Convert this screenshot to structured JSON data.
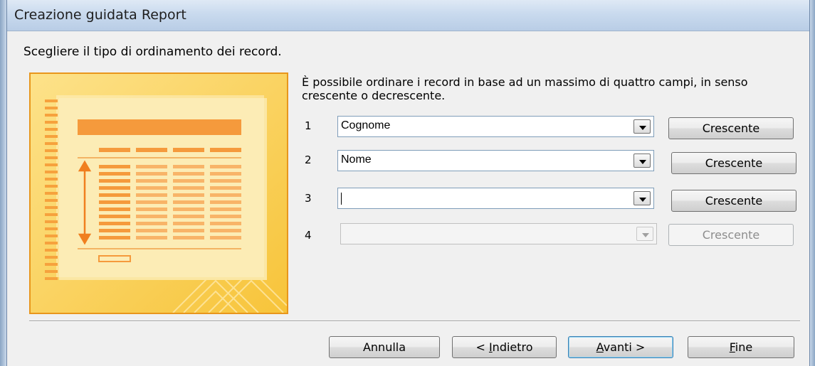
{
  "window": {
    "title": "Creazione guidata Report"
  },
  "header": {
    "text": "Scegliere il tipo di ordinamento dei record."
  },
  "description": "È possibile ordinare i record in base ad un massimo di quattro campi, in senso crescente o decrescente.",
  "sort_rows": [
    {
      "number": "1",
      "field": "Cognome",
      "order": "Crescente",
      "enabled": true
    },
    {
      "number": "2",
      "field": "Nome",
      "order": "Crescente",
      "enabled": true
    },
    {
      "number": "3",
      "field": "",
      "order": "Crescente",
      "enabled": true
    },
    {
      "number": "4",
      "field": "",
      "order": "Crescente",
      "enabled": false
    }
  ],
  "footer": {
    "cancel_label": "Annulla",
    "back_label_prefix": "< ",
    "back_label_accel": "I",
    "back_label_rest": "ndietro",
    "next_label_accel": "A",
    "next_label_rest": "vanti >",
    "finish_label_accel": "F",
    "finish_label_rest": "ine"
  },
  "colors": {
    "illustration_bg": "#fbd455",
    "illustration_border": "#e8961c",
    "accent_orange": "#f59a3c"
  }
}
